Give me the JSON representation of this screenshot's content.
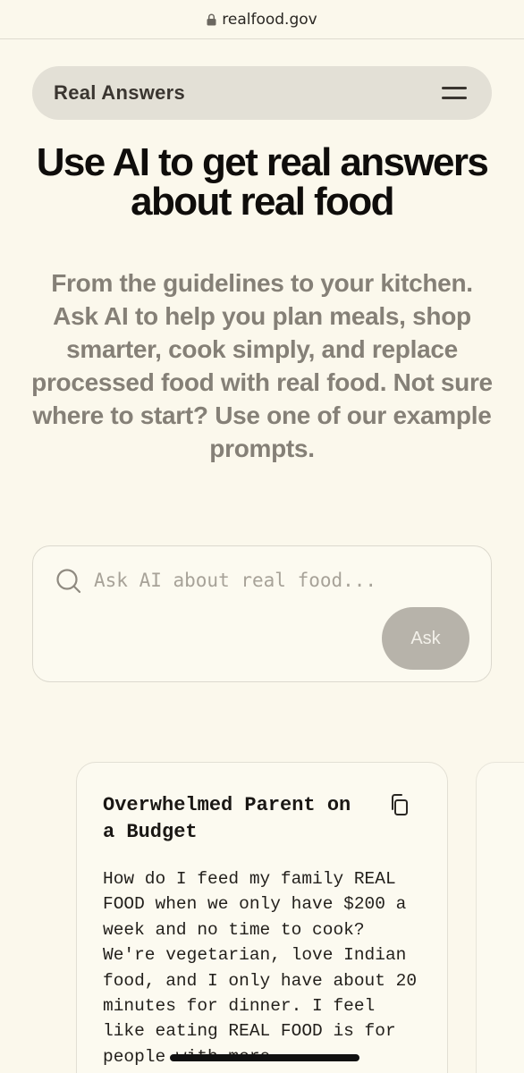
{
  "browser": {
    "url": "realfood.gov"
  },
  "nav": {
    "brand": "Real Answers"
  },
  "hero": {
    "title": "Use AI to get real answers about real food",
    "intro": "From the guidelines to your kitchen. Ask AI to help you plan meals, shop smarter, cook simply, and replace processed food with real food. Not sure where to start? Use one of our example prompts."
  },
  "ask": {
    "placeholder": "Ask AI about real food...",
    "button_label": "Ask"
  },
  "prompts": [
    {
      "title": "Overwhelmed Parent on a Budget",
      "body": "How do I feed my family REAL FOOD when we only have $200 a week and no time to cook? We're vegetarian, love Indian food, and I only have about 20 minutes for dinner. I feel like eating REAL FOOD is for people with more"
    }
  ],
  "colors": {
    "background": "#fbf8ec",
    "nav_pill": "#e3e0d6",
    "ask_button": "#b7b3aa",
    "intro_text": "#858077"
  }
}
